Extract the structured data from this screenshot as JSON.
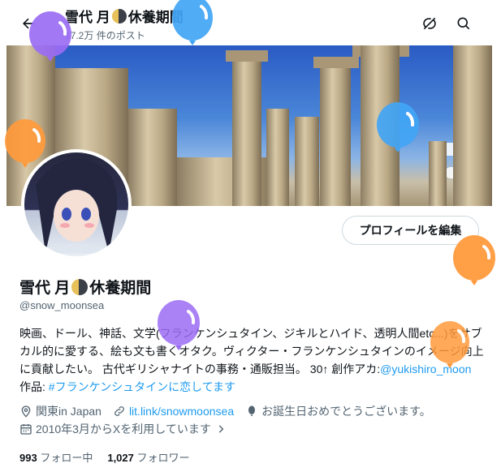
{
  "header": {
    "back_icon": "arrow-left-icon",
    "title_pre": "雪代 月",
    "title_post": "休養期間",
    "post_count": "17.2万 件のポスト",
    "icons": [
      "no-sync-icon",
      "search-icon"
    ]
  },
  "profile": {
    "edit_label": "プロフィールを編集",
    "name_pre": "雪代 月",
    "name_post": "休養期間",
    "handle": "@snow_moonsea",
    "bio_text": "映画、ドール、神話、文学(フランケンシュタイン、ジキルとハイド、透明人間etc...)をサブカル的に愛する、絵も文も書くオタク。ヴィクター・フランケンシュタインのイメージ向上に貢献したい。 古代ギリシャナイトの事務・通販担当。 30↑ 創作アカ:",
    "bio_link": "@yukishiro_moon",
    "bio_mid": " 作品: ",
    "bio_hashtag": "#フランケンシュタインに恋してます",
    "location": "関東in Japan",
    "website": "lit.link/snowmoonsea",
    "birthday": "お誕生日おめでとうございます。",
    "joined": "2010年3月からXを利用しています",
    "following_count": "993",
    "following_label": "フォロー中",
    "followers_count": "1,027",
    "followers_label": "フォロワー"
  },
  "colors": {
    "accent": "#1d9bf0",
    "secondary_text": "#536471",
    "balloon_purple": "#9b6cf4",
    "balloon_blue": "#42a5f5",
    "balloon_orange": "#ff9a3c"
  }
}
